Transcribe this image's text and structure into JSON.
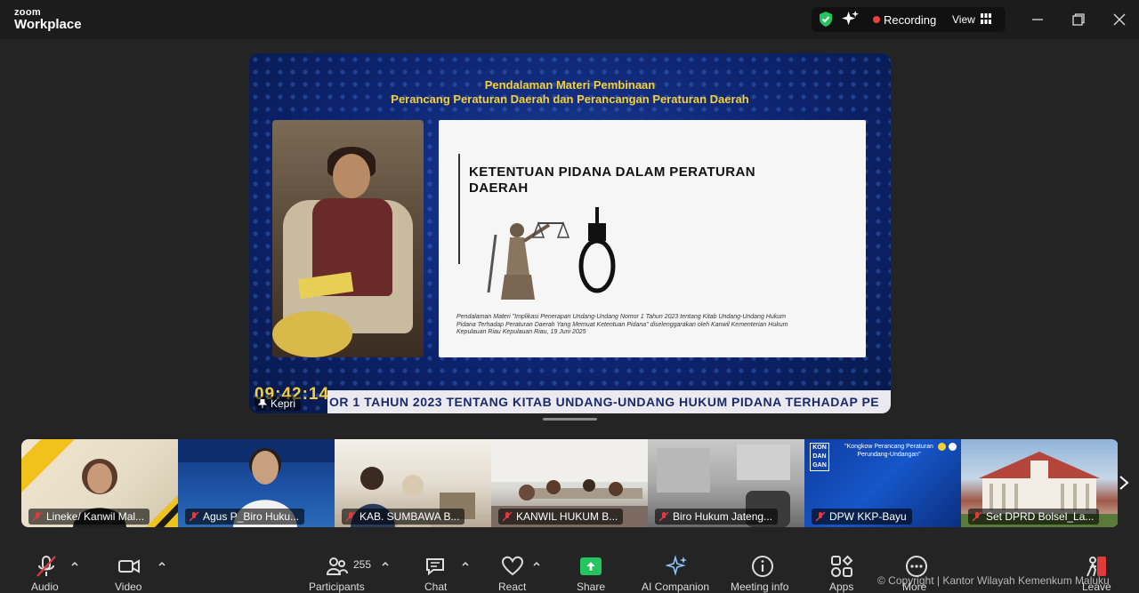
{
  "app": {
    "brand_small": "zoom",
    "brand_big": "Workplace"
  },
  "titlebar": {
    "recording_label": "Recording",
    "view_label": "View",
    "icons": [
      "shield-icon",
      "ai-sparkle-icon",
      "grid-icon",
      "minimize-icon",
      "maximize-icon",
      "close-icon"
    ]
  },
  "share": {
    "slide_heading1": "Pendalaman Materi Pembinaan",
    "slide_heading2": "Perancang Peraturan Daerah dan Perancangan Peraturan Daerah",
    "slide_title_line1": "KETENTUAN PIDANA DALAM PERATURAN",
    "slide_title_line2": "DAERAH",
    "slide_caption": "Pendalaman Materi \"Implikasi Penerapan Undang-Undang Nomor 1 Tahun 2023 tentang Kitab Undang-Undang Hukum Pidana Terhadap Peraturan Daerah Yang Memuat Ketentuan Pidana\" diselenggarakan oleh Kanwil Kementerian Hukum Kepulauan Riau Kepulauan Riau, 19 Juni 2025",
    "timer": "09:42:14",
    "ticker": "OR 1 TAHUN 2023 TENTANG KITAB UNDANG-UNDANG HUKUM PIDANA TERHADAP PE",
    "sharer_label": "Kepri"
  },
  "participants": [
    {
      "name": "Lineke/ Kanwil Mal..."
    },
    {
      "name": "Agus P_Biro Huku..."
    },
    {
      "name": "KAB. SUMBAWA B..."
    },
    {
      "name": "KANWIL HUKUM B..."
    },
    {
      "name": "Biro Hukum Jateng..."
    },
    {
      "name": "DPW KKP-Bayu"
    },
    {
      "name": "Set DPRD Bolsel_La..."
    }
  ],
  "tile_text": {
    "t6_logo": "KON DAN GAN",
    "t6_title": "\"Kongkow Perancang Peraturan Perundang-Undangan\""
  },
  "toolbar": {
    "audio": "Audio",
    "video": "Video",
    "participants": "Participants",
    "participants_count": "255",
    "chat": "Chat",
    "react": "React",
    "share": "Share",
    "ai_companion": "AI Companion",
    "meeting_info": "Meeting info",
    "apps": "Apps",
    "more": "More",
    "leave": "Leave"
  },
  "colors": {
    "accent_green": "#22c55e",
    "recording_red": "#e8413a",
    "slide_gold": "#f4cf3a",
    "muted_red": "#e03b3b"
  },
  "watermark": "© Copyright | Kantor Wilayah Kemenkum Maluku"
}
